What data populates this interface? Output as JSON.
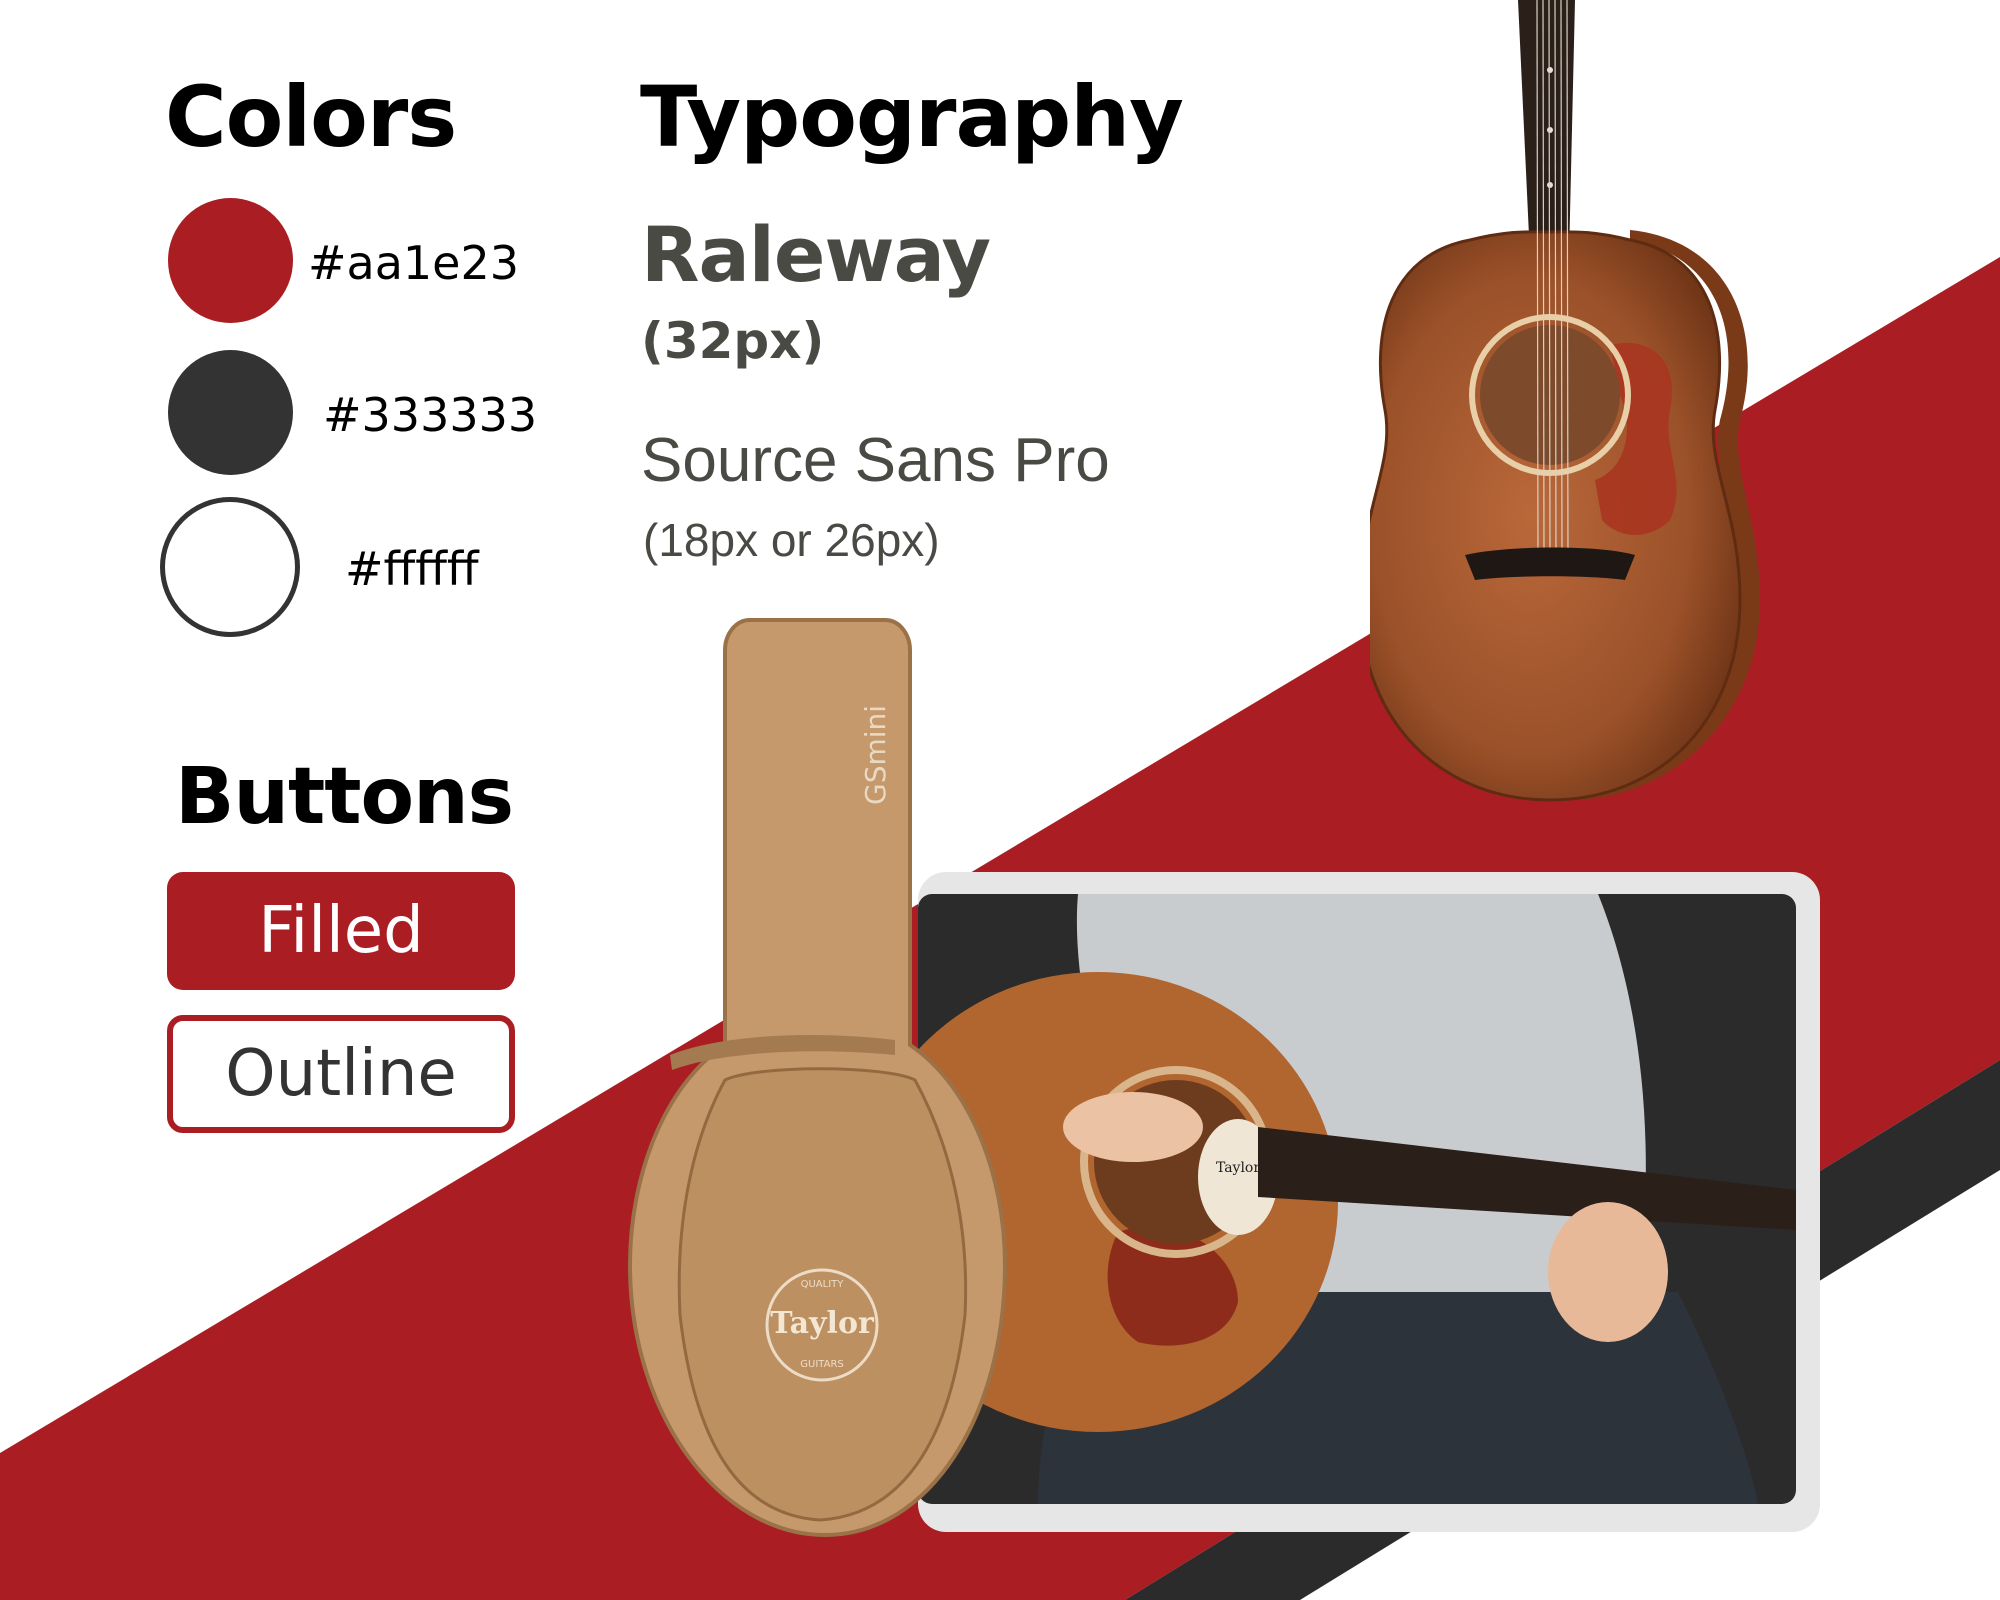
{
  "colors": {
    "heading": "Colors",
    "swatches": [
      {
        "hex": "#aa1e23",
        "label": "#aa1e23"
      },
      {
        "hex": "#333333",
        "label": "#333333"
      },
      {
        "hex": "#ffffff",
        "label": "#ffffff"
      }
    ]
  },
  "typography": {
    "heading": "Typography",
    "primary_font": "Raleway",
    "primary_size": "(32px)",
    "secondary_font": "Source Sans Pro",
    "secondary_size": "(18px or 26px)"
  },
  "buttons": {
    "heading": "Buttons",
    "filled_label": "Filled",
    "outline_label": "Outline"
  },
  "imagery": {
    "bag_brand_text": "GSmini",
    "bag_logo_text": "Taylor",
    "bag_logo_ring_top": "QUALITY",
    "bag_logo_ring_bottom": "GUITARS",
    "video_label_text": "Taylor"
  },
  "theme": {
    "accent": "#aa1e23",
    "dark": "#333333",
    "light": "#ffffff"
  }
}
